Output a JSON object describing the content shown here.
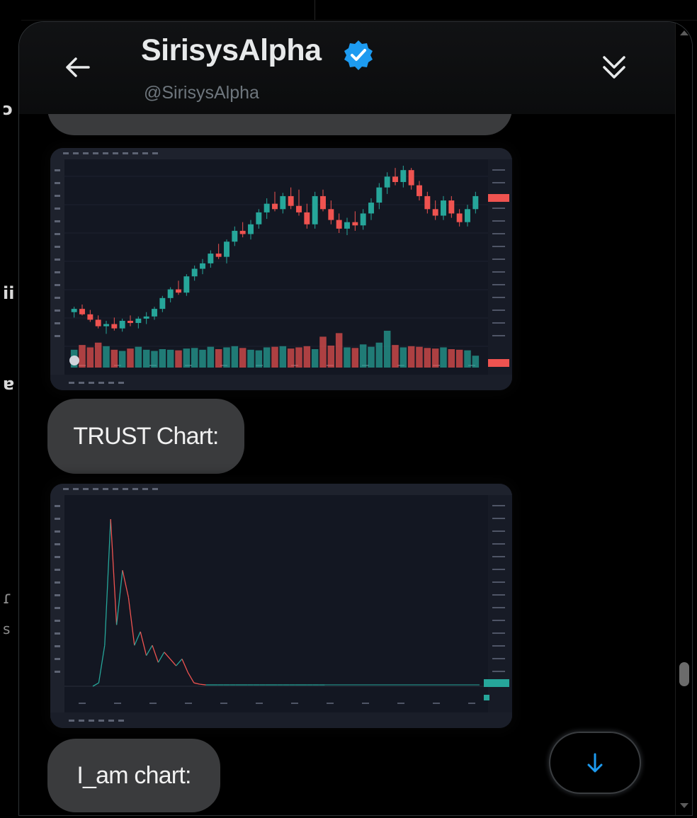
{
  "conversation": {
    "display_name": "SirisysAlpha",
    "handle": "@SirisysAlpha",
    "verified_icon": "verified-badge-icon",
    "back_icon": "arrow-left-icon",
    "collapse_icon": "double-chevron-down-icon"
  },
  "messages": [
    {
      "type": "image",
      "description_icon": "chart-image",
      "caption": ""
    },
    {
      "type": "text",
      "text": "TRUST Chart:"
    },
    {
      "type": "image",
      "description_icon": "chart-image",
      "caption": ""
    },
    {
      "type": "text",
      "text": "I_am chart:"
    }
  ],
  "controls": {
    "jump_to_bottom_icon": "arrow-down-icon"
  },
  "colors": {
    "accent": "#1d9bf0",
    "bubble": "#3a3b3d",
    "chart_bg": "#131722",
    "candle_up": "#26a69a",
    "candle_down": "#ef5350"
  },
  "chart_data": [
    {
      "type": "candlestick",
      "title": "",
      "xlabel": "",
      "ylabel": "",
      "candles": [
        [
          55,
          60,
          50,
          58
        ],
        [
          58,
          62,
          52,
          53
        ],
        [
          53,
          57,
          46,
          48
        ],
        [
          48,
          52,
          40,
          42
        ],
        [
          42,
          47,
          35,
          44
        ],
        [
          44,
          50,
          38,
          40
        ],
        [
          40,
          49,
          37,
          47
        ],
        [
          47,
          52,
          42,
          45
        ],
        [
          45,
          51,
          40,
          49
        ],
        [
          49,
          55,
          44,
          51
        ],
        [
          51,
          60,
          48,
          58
        ],
        [
          58,
          70,
          55,
          68
        ],
        [
          68,
          78,
          64,
          76
        ],
        [
          76,
          84,
          71,
          73
        ],
        [
          73,
          90,
          70,
          88
        ],
        [
          88,
          98,
          84,
          95
        ],
        [
          95,
          104,
          90,
          100
        ],
        [
          100,
          112,
          96,
          109
        ],
        [
          109,
          118,
          104,
          106
        ],
        [
          106,
          122,
          100,
          120
        ],
        [
          120,
          134,
          116,
          130
        ],
        [
          130,
          138,
          124,
          127
        ],
        [
          127,
          140,
          122,
          136
        ],
        [
          136,
          150,
          132,
          147
        ],
        [
          147,
          160,
          141,
          155
        ],
        [
          155,
          166,
          148,
          150
        ],
        [
          150,
          165,
          146,
          162
        ],
        [
          162,
          170,
          150,
          153
        ],
        [
          153,
          168,
          144,
          147
        ],
        [
          147,
          155,
          132,
          136
        ],
        [
          136,
          166,
          132,
          162
        ],
        [
          162,
          168,
          148,
          150
        ],
        [
          150,
          158,
          136,
          140
        ],
        [
          140,
          146,
          128,
          132
        ],
        [
          132,
          142,
          126,
          138
        ],
        [
          138,
          148,
          130,
          135
        ],
        [
          135,
          150,
          131,
          146
        ],
        [
          146,
          160,
          140,
          156
        ],
        [
          156,
          174,
          150,
          170
        ],
        [
          170,
          184,
          164,
          180
        ],
        [
          180,
          188,
          172,
          175
        ],
        [
          175,
          190,
          170,
          186
        ],
        [
          186,
          188,
          168,
          172
        ],
        [
          172,
          176,
          158,
          162
        ],
        [
          162,
          166,
          146,
          150
        ],
        [
          150,
          158,
          140,
          144
        ],
        [
          144,
          162,
          140,
          158
        ],
        [
          158,
          162,
          142,
          146
        ],
        [
          146,
          150,
          134,
          138
        ],
        [
          138,
          154,
          134,
          150
        ],
        [
          150,
          166,
          146,
          162
        ]
      ],
      "volumes": [
        30,
        38,
        34,
        42,
        36,
        30,
        28,
        32,
        35,
        30,
        28,
        31,
        30,
        29,
        32,
        33,
        30,
        35,
        31,
        34,
        36,
        33,
        30,
        29,
        34,
        35,
        36,
        32,
        34,
        36,
        31,
        52,
        37,
        58,
        34,
        33,
        39,
        35,
        42,
        62,
        38,
        34,
        36,
        35,
        33,
        32,
        34,
        31,
        30,
        29,
        20
      ]
    },
    {
      "type": "line",
      "title": "",
      "xlabel": "",
      "ylabel": "",
      "values": [
        0,
        5,
        60,
        245,
        90,
        170,
        130,
        60,
        80,
        45,
        60,
        35,
        50,
        40,
        30,
        40,
        20,
        5,
        3,
        2,
        2,
        2,
        2,
        2,
        2,
        2,
        2,
        2,
        2,
        2,
        2,
        2,
        2,
        2,
        2,
        2,
        2,
        2,
        2,
        2
      ]
    }
  ]
}
